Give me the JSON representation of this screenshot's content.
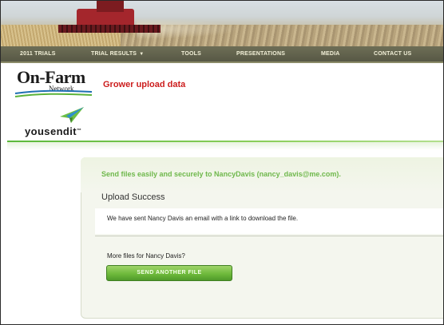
{
  "nav": {
    "items": [
      {
        "label": "2011 TRIALS"
      },
      {
        "label": "TRIAL RESULTS",
        "has_dropdown": true
      },
      {
        "label": "TOOLS"
      },
      {
        "label": "PRESENTATIONS"
      },
      {
        "label": "MEDIA"
      },
      {
        "label": "CONTACT US"
      }
    ],
    "caret": "▼"
  },
  "logo": {
    "main": "On-Farm",
    "sub": "Network"
  },
  "page_title": "Grower upload data",
  "partner": {
    "name": "yousendit",
    "trademark": "™"
  },
  "panel": {
    "send_message": "Send files easily and securely to NancyDavis (nancy_davis@me.com).",
    "upload_title": "Upload Success",
    "info": "We have sent Nancy Davis an email with a link to download the file.",
    "more_files": "More files for Nancy Davis?",
    "send_another_label": "SEND ANOTHER FILE"
  },
  "colors": {
    "nav_bg": "#575845",
    "title_red": "#cc1d1d",
    "accent_green": "#6fb84c",
    "button_green": "#6fba3c"
  },
  "icons": {
    "partner_logo": "paper-plane-icon",
    "logo_swoosh": "swoosh-icon"
  }
}
